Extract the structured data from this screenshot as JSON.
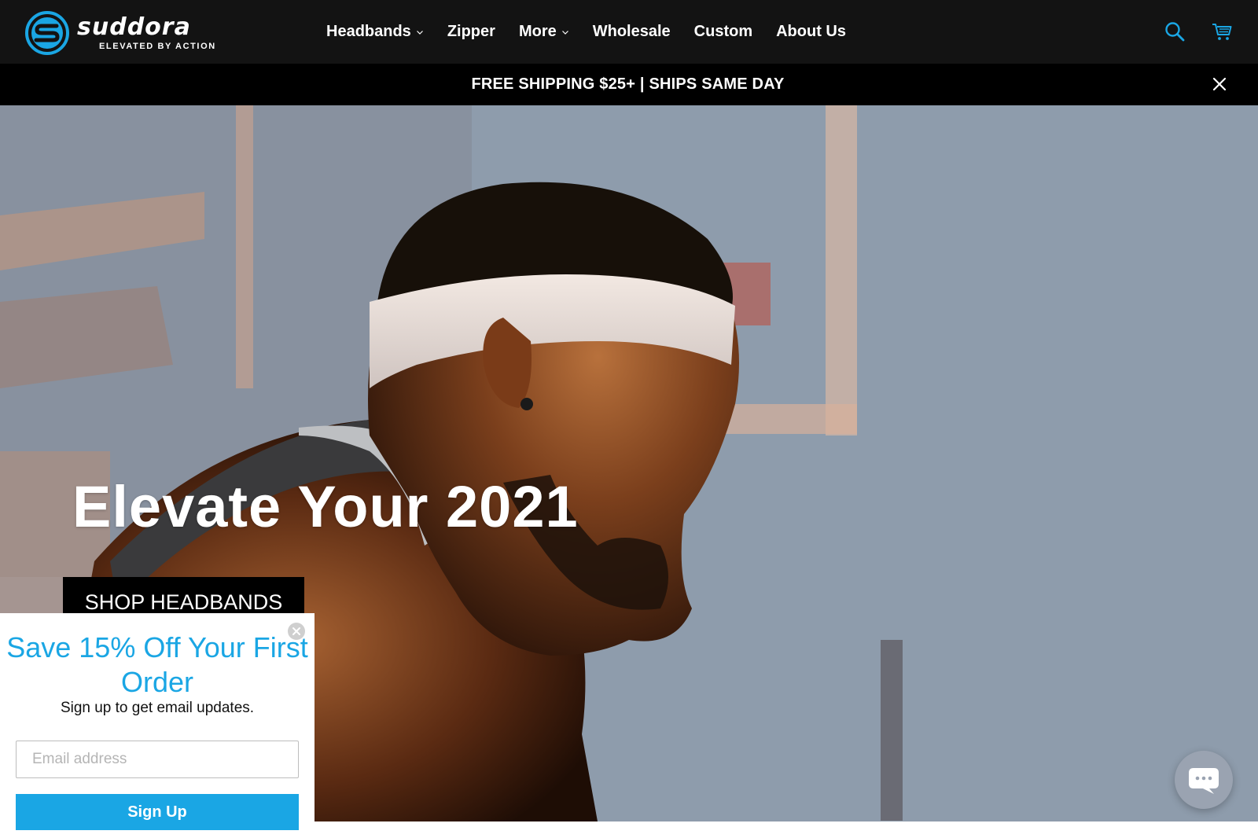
{
  "brand": {
    "name": "suddora",
    "tagline": "ELEVATED BY ACTION",
    "accent_color": "#1aa6e4"
  },
  "nav": {
    "items": [
      {
        "label": "Headbands",
        "has_dropdown": true
      },
      {
        "label": "Zipper",
        "has_dropdown": false
      },
      {
        "label": "More",
        "has_dropdown": true
      },
      {
        "label": "Wholesale",
        "has_dropdown": false
      },
      {
        "label": "Custom",
        "has_dropdown": false
      },
      {
        "label": "About Us",
        "has_dropdown": false
      }
    ],
    "icons": [
      "search-icon",
      "cart-icon"
    ]
  },
  "announcement": {
    "text": "FREE SHIPPING $25+ | SHIPS SAME DAY",
    "close_icon": "close-icon"
  },
  "hero": {
    "title": "Elevate Your 2021",
    "cta_label": "SHOP HEADBANDS"
  },
  "popup": {
    "title": "Save 15% Off Your First Order",
    "subtitle": "Sign up to get email updates.",
    "email_placeholder": "Email address",
    "submit_label": "Sign Up",
    "close_icon": "close-circle-icon"
  },
  "chat": {
    "icon": "chat-bubble-icon"
  }
}
